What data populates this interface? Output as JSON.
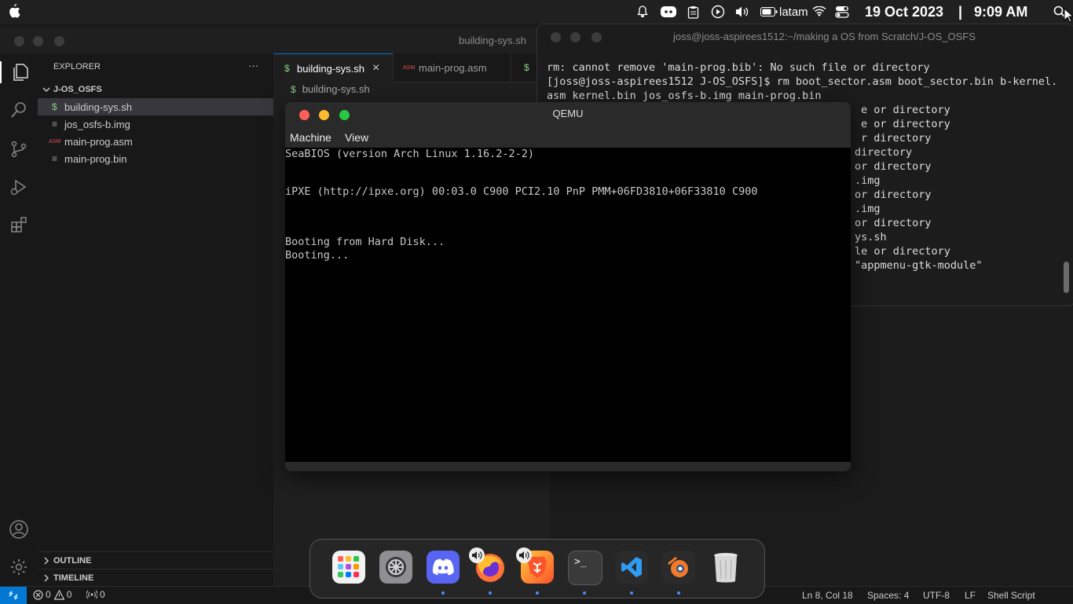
{
  "menubar": {
    "keyboard_layout": "latam",
    "date": "19 Oct 2023",
    "separator": "|",
    "time": "9:09 AM"
  },
  "vscode": {
    "window_title": "building-sys.sh",
    "explorer": {
      "title": "EXPLORER",
      "more": "···",
      "folder": "J-OS_OSFS",
      "files": [
        {
          "name": "building-sys.sh",
          "icon": "$"
        },
        {
          "name": "jos_osfs-b.img",
          "icon": "≡"
        },
        {
          "name": "main-prog.asm",
          "icon": "ASM"
        },
        {
          "name": "main-prog.bin",
          "icon": "≡"
        }
      ],
      "outline": "OUTLINE",
      "timeline": "TIMELINE"
    },
    "tabs": [
      {
        "label": "building-sys.sh",
        "icon": "$",
        "close": "×"
      },
      {
        "label": "main-prog.asm",
        "icon": "ASM"
      },
      {
        "label": "",
        "icon": "$"
      }
    ],
    "breadcrumb": "building-sys.sh",
    "statusbar": {
      "errors": "0",
      "warnings": "0",
      "ports": "0",
      "position": "Ln 8, Col 18",
      "spaces": "Spaces: 4",
      "encoding": "UTF-8",
      "eol": "LF",
      "language": "Shell Script"
    }
  },
  "terminal": {
    "title": "joss@joss-aspirees1512:~/making a OS from Scratch/J-OS_OSFS",
    "lines": [
      "rm: cannot remove 'main-prog.bib': No such file or directory",
      "[joss@joss-aspirees1512 J-OS_OSFS]$ rm boot_sector.asm boot_sector.bin b-kernel.",
      "asm kernel.bin jos_osfs-b.img main-prog.bin"
    ],
    "right_lines": [
      "e or directory",
      "e or directory",
      "r directory",
      "directory",
      "or directory",
      ".img",
      "or directory",
      ".img",
      "or directory",
      "ys.sh",
      "le or directory",
      "\"appmenu-gtk-module\""
    ]
  },
  "qemu": {
    "title": "QEMU",
    "menu": [
      "Machine",
      "View"
    ],
    "screen_lines": [
      "SeaBIOS (version Arch Linux 1.16.2-2-2)",
      "",
      "",
      "iPXE (http://ipxe.org) 00:03.0 C900 PCI2.10 PnP PMM+06FD3810+06F33810 C900",
      "",
      "",
      "",
      "Booting from Hard Disk...",
      "Booting..."
    ]
  },
  "dock": {
    "items": [
      {
        "name": "launchpad",
        "color": "#ffffff"
      },
      {
        "name": "system-settings",
        "color": "#8e8e93"
      },
      {
        "name": "discord",
        "color": "#5865f2"
      },
      {
        "name": "firefox",
        "color": "#ff7139"
      },
      {
        "name": "brave",
        "color": "#fb542b"
      },
      {
        "name": "terminal",
        "color": "#3a3a3a"
      },
      {
        "name": "vscode",
        "color": "#2b2b2b"
      },
      {
        "name": "blender",
        "color": "#2b2b2b"
      },
      {
        "name": "trash",
        "color": "#d8d8d8"
      }
    ],
    "terminal_glyph": ">_"
  }
}
